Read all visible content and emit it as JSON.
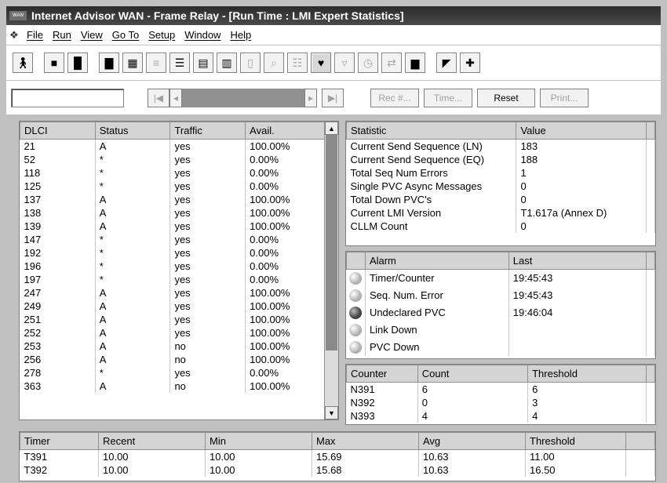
{
  "window": {
    "title": "Internet Advisor WAN - Frame Relay - [Run Time : LMI Expert Statistics]",
    "logo_text": "WAN"
  },
  "menu": {
    "items": [
      "File",
      "Run",
      "View",
      "Go To",
      "Setup",
      "Window",
      "Help"
    ]
  },
  "navbar": {
    "rec_label": "Rec #...",
    "time_label": "Time...",
    "reset_label": "Reset",
    "print_label": "Print..."
  },
  "dlci_table": {
    "headers": [
      "DLCI",
      "Status",
      "Traffic",
      "Avail."
    ],
    "rows": [
      [
        "21",
        "A",
        "yes",
        "100.00%"
      ],
      [
        "52",
        "*",
        "yes",
        "0.00%"
      ],
      [
        "118",
        "*",
        "yes",
        "0.00%"
      ],
      [
        "125",
        "*",
        "yes",
        "0.00%"
      ],
      [
        "137",
        "A",
        "yes",
        "100.00%"
      ],
      [
        "138",
        "A",
        "yes",
        "100.00%"
      ],
      [
        "139",
        "A",
        "yes",
        "100.00%"
      ],
      [
        "147",
        "*",
        "yes",
        "0.00%"
      ],
      [
        "192",
        "*",
        "yes",
        "0.00%"
      ],
      [
        "196",
        "*",
        "yes",
        "0.00%"
      ],
      [
        "197",
        "*",
        "yes",
        "0.00%"
      ],
      [
        "247",
        "A",
        "yes",
        "100.00%"
      ],
      [
        "249",
        "A",
        "yes",
        "100.00%"
      ],
      [
        "251",
        "A",
        "yes",
        "100.00%"
      ],
      [
        "252",
        "A",
        "yes",
        "100.00%"
      ],
      [
        "253",
        "A",
        "no",
        "100.00%"
      ],
      [
        "256",
        "A",
        "no",
        "100.00%"
      ],
      [
        "278",
        "*",
        "yes",
        "0.00%"
      ],
      [
        "363",
        "A",
        "no",
        "100.00%"
      ]
    ]
  },
  "stats_table": {
    "headers": [
      "Statistic",
      "Value"
    ],
    "rows": [
      [
        "Current Send Sequence (LN)",
        "183"
      ],
      [
        "Current Send Sequence (EQ)",
        "188"
      ],
      [
        "Total Seq Num Errors",
        "1"
      ],
      [
        "Single PVC Async Messages",
        "0"
      ],
      [
        "Total Down PVC's",
        "0"
      ],
      [
        "Current LMI Version",
        "T1.617a (Annex D)"
      ],
      [
        "CLLM Count",
        "0"
      ]
    ]
  },
  "alarm_table": {
    "headers": [
      "Alarm",
      "Last"
    ],
    "rows": [
      {
        "name": "Timer/Counter",
        "last": "19:45:43",
        "led": "light"
      },
      {
        "name": "Seq. Num. Error",
        "last": "19:45:43",
        "led": "light"
      },
      {
        "name": "Undeclared PVC",
        "last": "19:46:04",
        "led": "dark"
      },
      {
        "name": "Link Down",
        "last": "",
        "led": "light"
      },
      {
        "name": "PVC Down",
        "last": "",
        "led": "light"
      }
    ]
  },
  "counter_table": {
    "headers": [
      "Counter",
      "Count",
      "Threshold"
    ],
    "rows": [
      [
        "N391",
        "6",
        "6"
      ],
      [
        "N392",
        "0",
        "3"
      ],
      [
        "N393",
        "4",
        "4"
      ]
    ]
  },
  "timer_table": {
    "headers": [
      "Timer",
      "Recent",
      "Min",
      "Max",
      "Avg",
      "Threshold"
    ],
    "rows": [
      [
        "T391",
        "10.00",
        "10.00",
        "15.69",
        "10.63",
        "11.00"
      ],
      [
        "T392",
        "10.00",
        "10.00",
        "15.68",
        "10.63",
        "16.50"
      ]
    ]
  }
}
